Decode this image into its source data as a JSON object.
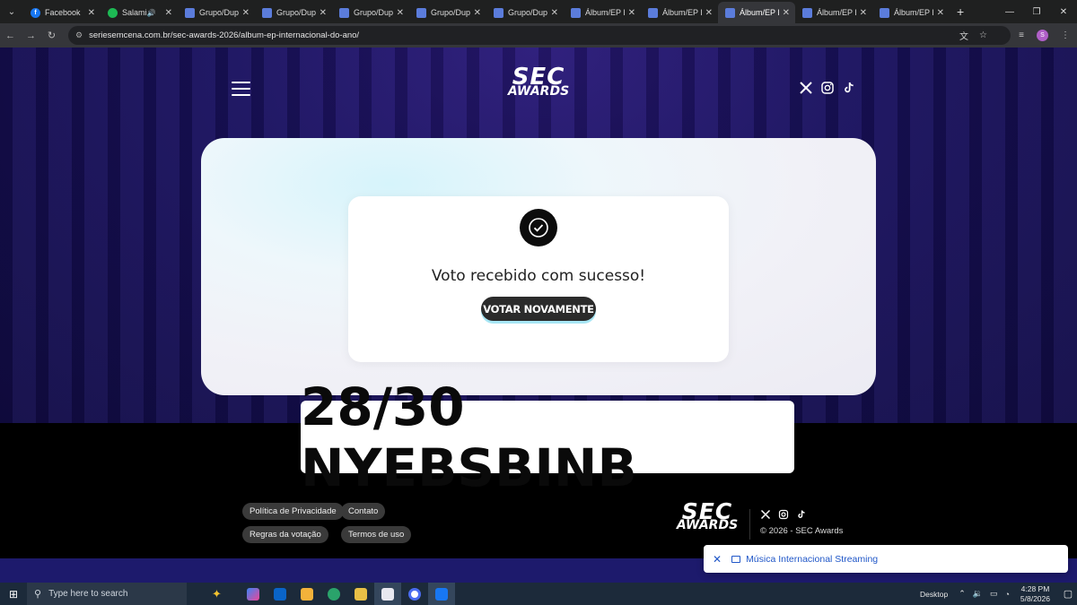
{
  "browser": {
    "tabs": [
      {
        "title": "Facebook",
        "favicon": "facebook-icon",
        "active": false
      },
      {
        "title": "Salamin",
        "favicon": "spotify-icon",
        "audio": true,
        "active": false
      },
      {
        "title": "Grupo/Dupl",
        "favicon": "sec-icon",
        "active": false
      },
      {
        "title": "Grupo/Dupl",
        "favicon": "sec-icon",
        "active": false
      },
      {
        "title": "Grupo/Dupl",
        "favicon": "sec-icon",
        "active": false
      },
      {
        "title": "Grupo/Dupl",
        "favicon": "sec-icon",
        "active": false
      },
      {
        "title": "Grupo/Dupl",
        "favicon": "sec-icon",
        "active": false
      },
      {
        "title": "Álbum/EP In",
        "favicon": "sec-icon",
        "active": false
      },
      {
        "title": "Álbum/EP In",
        "favicon": "sec-icon",
        "active": false
      },
      {
        "title": "Álbum/EP In",
        "favicon": "sec-icon",
        "active": true
      },
      {
        "title": "Álbum/EP In",
        "favicon": "sec-icon",
        "active": false
      },
      {
        "title": "Álbum/EP In",
        "favicon": "sec-icon",
        "active": false
      }
    ],
    "url": "seriesemcena.com.br/sec-awards-2026/album-ep-internacional-do-ano/",
    "profile_initial": "S"
  },
  "header": {
    "logo_line1": "SEC",
    "logo_line2": "AWARDS",
    "social": [
      "x-icon",
      "instagram-icon",
      "tiktok-icon"
    ]
  },
  "confirmation": {
    "message": "Voto recebido com sucesso!",
    "button_label": "VOTAR NOVAMENTE"
  },
  "overlay_banner": {
    "text": "28/30 NYEBSBINB"
  },
  "footer": {
    "links": [
      "Política de Privacidade",
      "Contato",
      "Regras da votação",
      "Termos de uso"
    ],
    "copyright": "© 2026 - SEC Awards",
    "logo_line1": "SEC",
    "logo_line2": "AWARDS"
  },
  "toast": {
    "label": "Música Internacional Streaming"
  },
  "taskbar": {
    "search_placeholder": "Type here to search",
    "desktop_label": "Desktop",
    "time": "4:28 PM",
    "date": "5/8/2026"
  },
  "colors": {
    "hero_bg": "#1a1260",
    "footer_bg": "#000000",
    "button_bg": "#2b2b2b",
    "toast_text": "#2057c8"
  }
}
